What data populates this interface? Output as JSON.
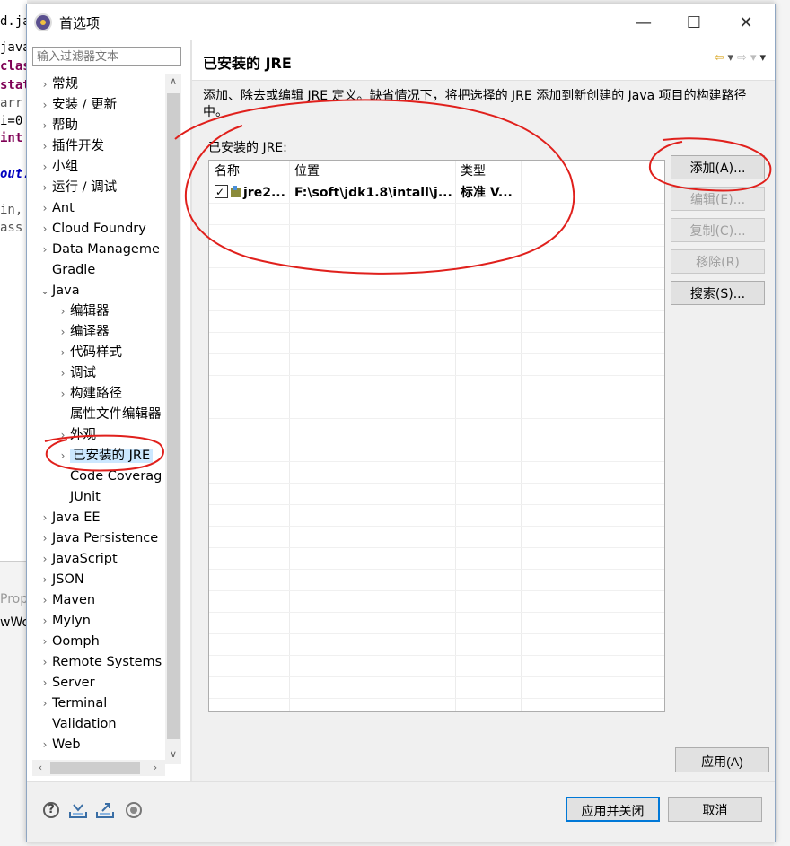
{
  "background_editor": {
    "lines": [
      "d.jav",
      "java",
      "clas",
      "stat",
      "arr",
      "i=0",
      "int",
      "",
      "out.",
      "",
      "in,",
      "ass"
    ],
    "bottom_tab": "Prop",
    "bottom_text": "wWo"
  },
  "window": {
    "title": "首选项",
    "minimize": "—",
    "maximize": "☐",
    "close": "✕"
  },
  "filter": {
    "placeholder": "输入过滤器文本"
  },
  "tree": [
    {
      "label": "常规",
      "expander": "›",
      "indent": 0
    },
    {
      "label": "安装 / 更新",
      "expander": "›",
      "indent": 0
    },
    {
      "label": "帮助",
      "expander": "›",
      "indent": 0
    },
    {
      "label": "插件开发",
      "expander": "›",
      "indent": 0
    },
    {
      "label": "小组",
      "expander": "›",
      "indent": 0
    },
    {
      "label": "运行 / 调试",
      "expander": "›",
      "indent": 0
    },
    {
      "label": "Ant",
      "expander": "›",
      "indent": 0
    },
    {
      "label": "Cloud Foundry",
      "expander": "›",
      "indent": 0
    },
    {
      "label": "Data Manageme",
      "expander": "›",
      "indent": 0
    },
    {
      "label": "Gradle",
      "expander": "",
      "indent": 0
    },
    {
      "label": "Java",
      "expander": "⌄",
      "indent": 0
    },
    {
      "label": "编辑器",
      "expander": "›",
      "indent": 1
    },
    {
      "label": "编译器",
      "expander": "›",
      "indent": 1
    },
    {
      "label": "代码样式",
      "expander": "›",
      "indent": 1
    },
    {
      "label": "调试",
      "expander": "›",
      "indent": 1
    },
    {
      "label": "构建路径",
      "expander": "›",
      "indent": 1
    },
    {
      "label": "属性文件编辑器",
      "expander": "",
      "indent": 1
    },
    {
      "label": "外观",
      "expander": "›",
      "indent": 1
    },
    {
      "label": "已安装的 JRE",
      "expander": "›",
      "indent": 1,
      "selected": true
    },
    {
      "label": "Code Coverag",
      "expander": "",
      "indent": 1
    },
    {
      "label": "JUnit",
      "expander": "",
      "indent": 1
    },
    {
      "label": "Java EE",
      "expander": "›",
      "indent": 0
    },
    {
      "label": "Java Persistence",
      "expander": "›",
      "indent": 0
    },
    {
      "label": "JavaScript",
      "expander": "›",
      "indent": 0
    },
    {
      "label": "JSON",
      "expander": "›",
      "indent": 0
    },
    {
      "label": "Maven",
      "expander": "›",
      "indent": 0
    },
    {
      "label": "Mylyn",
      "expander": "›",
      "indent": 0
    },
    {
      "label": "Oomph",
      "expander": "›",
      "indent": 0
    },
    {
      "label": "Remote Systems",
      "expander": "›",
      "indent": 0
    },
    {
      "label": "Server",
      "expander": "›",
      "indent": 0
    },
    {
      "label": "Terminal",
      "expander": "›",
      "indent": 0
    },
    {
      "label": "Validation",
      "expander": "",
      "indent": 0
    },
    {
      "label": "Web",
      "expander": "›",
      "indent": 0
    }
  ],
  "scroll": {
    "up": "∧",
    "down": "∨",
    "left": "‹",
    "right": "›"
  },
  "page": {
    "title": "已安装的 JRE",
    "description": "添加、除去或编辑 JRE 定义。缺省情况下，将把选择的 JRE 添加到新创建的 Java 项目的构建路径中。",
    "list_label": "已安装的 JRE:",
    "nav": {
      "back": "⇦",
      "back_menu": "▾",
      "forward": "⇨",
      "forward_menu": "▾",
      "menu": "▾"
    },
    "table": {
      "columns": [
        "名称",
        "位置",
        "类型"
      ],
      "rows": [
        {
          "checked": true,
          "name": "jre2...",
          "location": "F:\\soft\\jdk1.8\\intall\\j...",
          "type": "标准 V..."
        }
      ]
    },
    "buttons": {
      "add": "添加(A)...",
      "edit": "编辑(E)...",
      "copy": "复制(C)...",
      "remove": "移除(R)",
      "search": "搜索(S)..."
    },
    "apply": "应用(A)"
  },
  "footer": {
    "help_icon": "?",
    "apply_close": "应用并关闭",
    "cancel": "取消"
  },
  "colors": {
    "selection": "#cce8ff",
    "annotation": "#e0201c",
    "primary_border": "#0078d7"
  }
}
